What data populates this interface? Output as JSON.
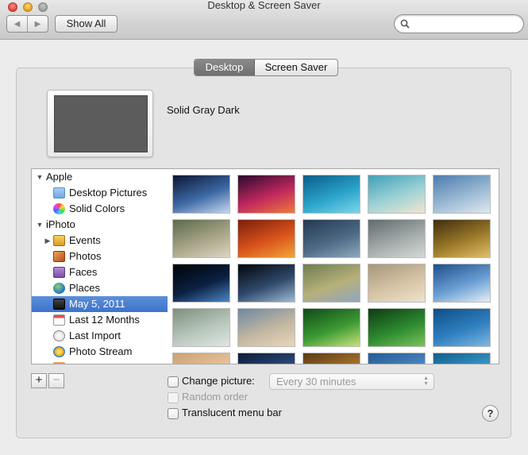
{
  "window": {
    "title": "Desktop & Screen Saver"
  },
  "toolbar": {
    "show_all_label": "Show All",
    "back_glyph": "◀",
    "forward_glyph": "▶"
  },
  "search": {
    "value": "",
    "placeholder": ""
  },
  "tabs": [
    {
      "label": "Desktop",
      "selected": true
    },
    {
      "label": "Screen Saver",
      "selected": false
    }
  ],
  "preview": {
    "name": "Solid Gray Dark",
    "color": "#5c5c5c"
  },
  "source_list": {
    "items": [
      {
        "label": "Apple",
        "type": "group",
        "expanded": true
      },
      {
        "label": "Desktop Pictures",
        "icon": "folder-icon"
      },
      {
        "label": "Solid Colors",
        "icon": "color-wheel-icon"
      },
      {
        "label": "iPhoto",
        "type": "group",
        "expanded": true
      },
      {
        "label": "Events",
        "icon": "events-icon",
        "collapsed": true
      },
      {
        "label": "Photos",
        "icon": "photos-icon"
      },
      {
        "label": "Faces",
        "icon": "faces-icon"
      },
      {
        "label": "Places",
        "icon": "globe-icon"
      },
      {
        "label": "May 5, 2011",
        "icon": "album-icon",
        "selected": true
      },
      {
        "label": "Last 12 Months",
        "icon": "calendar-icon"
      },
      {
        "label": "Last Import",
        "icon": "import-icon"
      },
      {
        "label": "Photo Stream",
        "icon": "photo-stream-icon"
      }
    ]
  },
  "wallpapers": [
    {
      "name": "galaxy",
      "colors": [
        "#0b1533",
        "#3d6aa6",
        "#c7d6ee"
      ]
    },
    {
      "name": "antelope-canyon",
      "colors": [
        "#2a0a2e",
        "#c0285e",
        "#f07a3a"
      ]
    },
    {
      "name": "blue-water",
      "colors": [
        "#0c5c8a",
        "#2aa3c9",
        "#7dd6ea"
      ]
    },
    {
      "name": "beach",
      "colors": [
        "#3fa0b7",
        "#9fd2d5",
        "#f0e6d0"
      ]
    },
    {
      "name": "winter-trees",
      "colors": [
        "#4c7cad",
        "#9bb9d3",
        "#dfe9f1"
      ]
    },
    {
      "name": "grass-field",
      "colors": [
        "#5a6a4a",
        "#a9a589",
        "#dcd6c2"
      ]
    },
    {
      "name": "autumn-leaves",
      "colors": [
        "#7a1e08",
        "#d9531c",
        "#f3a53a"
      ]
    },
    {
      "name": "rain-ripples",
      "colors": [
        "#24384f",
        "#4d6985",
        "#8fa8be"
      ]
    },
    {
      "name": "foggy-lake",
      "colors": [
        "#5f6b6c",
        "#a4acab",
        "#d5d9d7"
      ]
    },
    {
      "name": "golden-forest",
      "colors": [
        "#3e2d0f",
        "#9c7a2a",
        "#e1c06a"
      ]
    },
    {
      "name": "earth-horizon",
      "colors": [
        "#000306",
        "#0b2042",
        "#4d86c6"
      ]
    },
    {
      "name": "earth-space",
      "colors": [
        "#02050a",
        "#304a6c",
        "#9ebad3"
      ]
    },
    {
      "name": "elephant",
      "colors": [
        "#6e7d4f",
        "#b7b07a",
        "#8fa6bf"
      ]
    },
    {
      "name": "flamingos",
      "colors": [
        "#a8957a",
        "#d5c4a5",
        "#efe3cd"
      ]
    },
    {
      "name": "ice-floes",
      "colors": [
        "#1d4e8b",
        "#6a9fd3",
        "#e6eef6"
      ]
    },
    {
      "name": "lily-pads",
      "colors": [
        "#7e8f7a",
        "#b8c6bd",
        "#e0e6e3"
      ]
    },
    {
      "name": "abstract-mist",
      "colors": [
        "#6d87a3",
        "#c3b7a0",
        "#e8d7bd"
      ]
    },
    {
      "name": "frog",
      "colors": [
        "#0f4a18",
        "#3c9a33",
        "#c8e27a"
      ]
    },
    {
      "name": "green-grass",
      "colors": [
        "#0d3b12",
        "#2d8a30",
        "#7cc35a"
      ]
    },
    {
      "name": "blue-texture",
      "colors": [
        "#0e4e86",
        "#2f7fbf",
        "#7fb7e2"
      ]
    },
    {
      "name": "sunset-partial",
      "colors": [
        "#caa172",
        "#e8c49c",
        "#f4e2c8"
      ]
    },
    {
      "name": "dark-blue-partial",
      "colors": [
        "#0b1c3a",
        "#2d4a7a",
        "#6d8dbd"
      ]
    },
    {
      "name": "lion-partial",
      "colors": [
        "#5a3a14",
        "#a8742c",
        "#e0b76a"
      ]
    },
    {
      "name": "blue-sky-partial",
      "colors": [
        "#245a96",
        "#4d86c1",
        "#a3c5e4"
      ]
    },
    {
      "name": "aqua-partial",
      "colors": [
        "#0f5e8c",
        "#3c97c4",
        "#8ccbe6"
      ]
    }
  ],
  "options": {
    "change_picture_label": "Change picture:",
    "interval_value": "Every 30 minutes",
    "random_order_label": "Random order",
    "translucent_label": "Translucent menu bar",
    "plus_label": "+",
    "minus_label": "−",
    "help_label": "?"
  },
  "colors": {
    "selection": "#3d72c9",
    "window_bg": "#ececec",
    "panel_bg": "#e4e4e4"
  }
}
